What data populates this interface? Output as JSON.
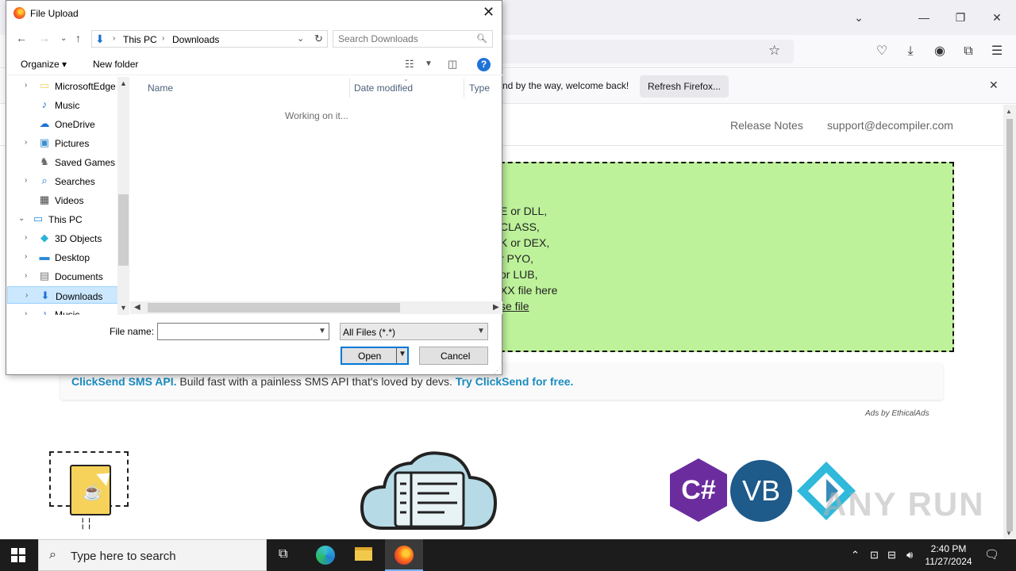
{
  "firefox": {
    "notification_text": "nd by the way, welcome back!",
    "refresh_button": "Refresh Firefox...",
    "notification_close": "✕"
  },
  "website": {
    "nav": [
      "Release Notes",
      "support@decompiler.com"
    ],
    "dropzone_lines": [
      "E or DLL,",
      "CLASS,",
      "K or DEX,",
      "r PYO,",
      "or LUB,",
      "XX file here"
    ],
    "dropzone_link": "se file",
    "ad": {
      "brand": "ClickSend SMS API.",
      "body": "Build fast with a painless SMS API that's loved by devs.",
      "cta": "Try ClickSend for free."
    },
    "ad_credit": "Ads by EthicalAds",
    "logos": [
      "C#",
      "VB"
    ],
    "watermark": "ANY RUN"
  },
  "dialog": {
    "title": "File Upload",
    "address": {
      "segments": [
        "This PC",
        "Downloads"
      ]
    },
    "search_placeholder": "Search Downloads",
    "commands": {
      "organize": "Organize ▾",
      "new_folder": "New folder"
    },
    "nav_tree": [
      {
        "label": "MicrosoftEdge",
        "icon": "folder-icon",
        "chevron": "›"
      },
      {
        "label": "Music",
        "icon": "music-icon",
        "chevron": ""
      },
      {
        "label": "OneDrive",
        "icon": "onedrive-icon",
        "chevron": ""
      },
      {
        "label": "Pictures",
        "icon": "pictures-icon",
        "chevron": "›"
      },
      {
        "label": "Saved Games",
        "icon": "saved-games-icon",
        "chevron": ""
      },
      {
        "label": "Searches",
        "icon": "searches-icon",
        "chevron": "›"
      },
      {
        "label": "Videos",
        "icon": "videos-icon",
        "chevron": ""
      },
      {
        "label": "This PC",
        "icon": "this-pc-icon",
        "chevron": "⌄"
      },
      {
        "label": "3D Objects",
        "icon": "3d-objects-icon",
        "chevron": "›"
      },
      {
        "label": "Desktop",
        "icon": "desktop-icon",
        "chevron": "›"
      },
      {
        "label": "Documents",
        "icon": "documents-icon",
        "chevron": "›"
      },
      {
        "label": "Downloads",
        "icon": "downloads-icon",
        "chevron": "›",
        "selected": true
      },
      {
        "label": "Music",
        "icon": "music-icon",
        "chevron": "›"
      }
    ],
    "columns": [
      "Name",
      "Date modified",
      "Type"
    ],
    "status": "Working on it...",
    "file_name_label": "File name:",
    "file_name_value": "",
    "file_type": "All Files (*.*)",
    "open_button": "Open",
    "cancel_button": "Cancel"
  },
  "taskbar": {
    "search_placeholder": "Type here to search",
    "time": "2:40 PM",
    "date": "11/27/2024"
  }
}
